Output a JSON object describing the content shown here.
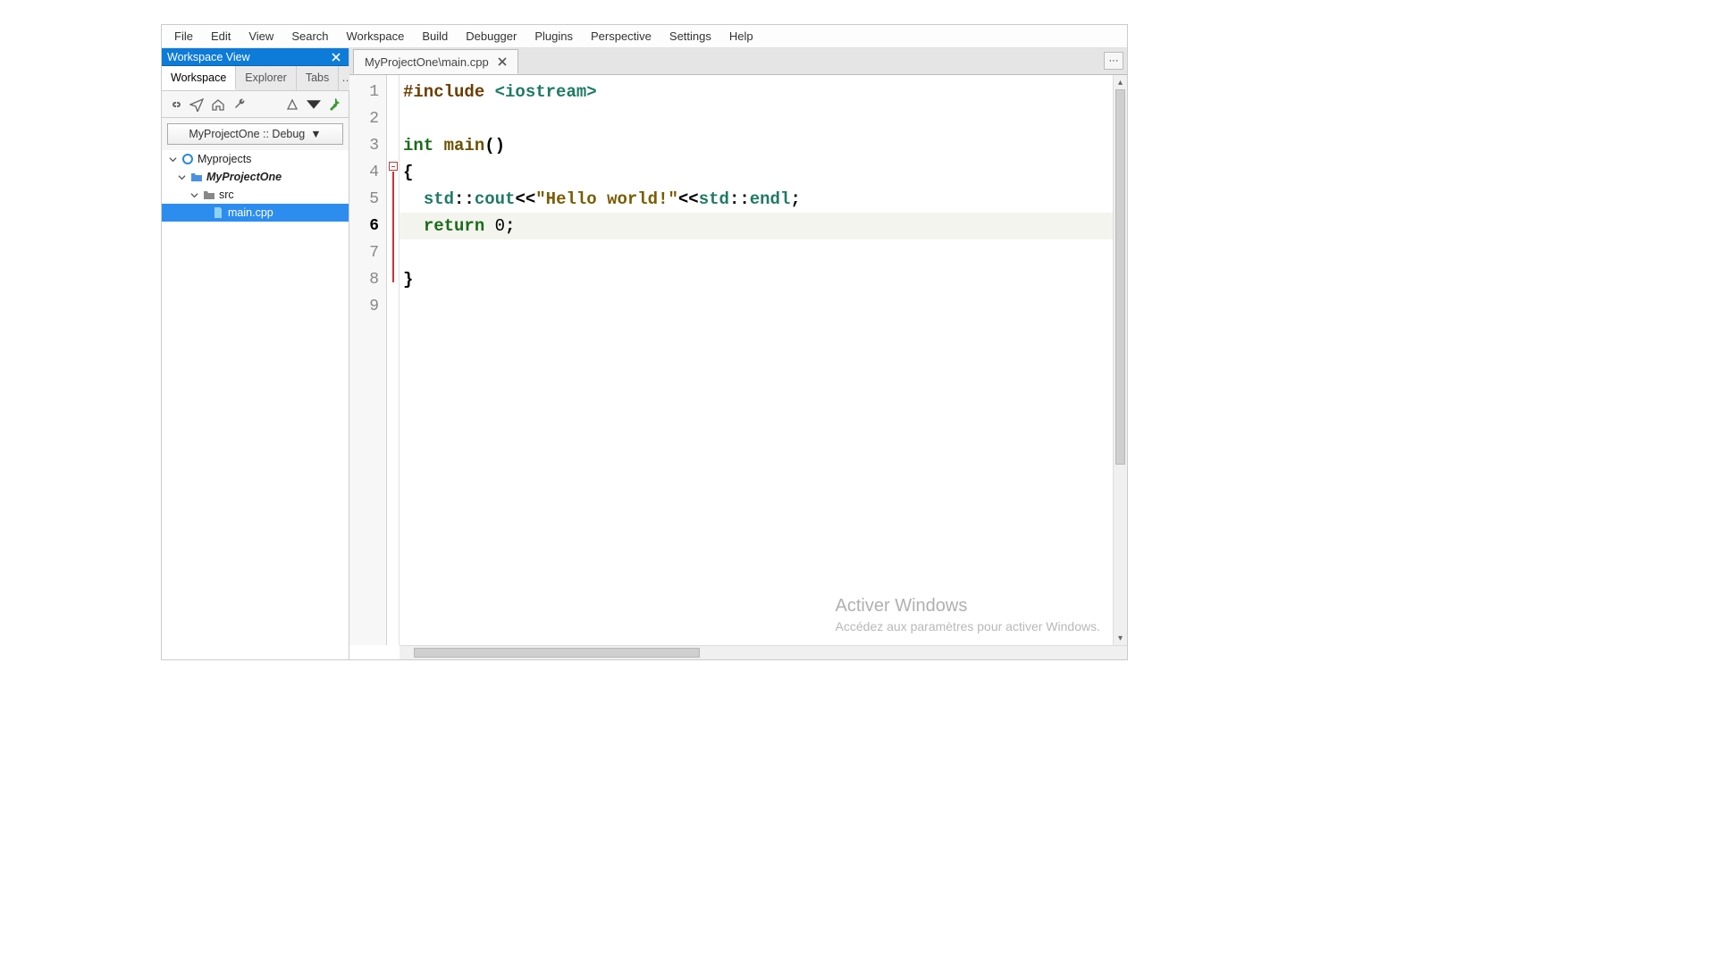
{
  "menu": {
    "items": [
      "File",
      "Edit",
      "View",
      "Search",
      "Workspace",
      "Build",
      "Debugger",
      "Plugins",
      "Perspective",
      "Settings",
      "Help"
    ]
  },
  "sidebar": {
    "panel_title": "Workspace View",
    "tabs": [
      "Workspace",
      "Explorer",
      "Tabs"
    ],
    "config": "MyProjectOne :: Debug",
    "tree": {
      "root": "Myprojects",
      "project": "MyProjectOne",
      "folder": "src",
      "file": "main.cpp"
    }
  },
  "editor": {
    "tab_label": "MyProjectOne\\main.cpp",
    "overflow_label": "···",
    "current_line": 6,
    "lines": [
      {
        "n": 1,
        "tokens": [
          [
            "pp",
            "#include "
          ],
          [
            "inc",
            "<iostream>"
          ]
        ]
      },
      {
        "n": 2,
        "tokens": []
      },
      {
        "n": 3,
        "tokens": [
          [
            "kw",
            "int "
          ],
          [
            "fn",
            "main"
          ],
          [
            "punct",
            "()"
          ]
        ]
      },
      {
        "n": 4,
        "tokens": [
          [
            "punct",
            "{"
          ]
        ]
      },
      {
        "n": 5,
        "tokens": [
          [
            "punct",
            "  "
          ],
          [
            "ident",
            "std"
          ],
          [
            "punct",
            "::"
          ],
          [
            "ident",
            "cout"
          ],
          [
            "punct",
            "<<"
          ],
          [
            "str",
            "\"Hello world!\""
          ],
          [
            "punct",
            "<<"
          ],
          [
            "ident",
            "std"
          ],
          [
            "punct",
            "::"
          ],
          [
            "ident",
            "endl"
          ],
          [
            "punct",
            ";"
          ]
        ]
      },
      {
        "n": 6,
        "tokens": [
          [
            "punct",
            "  "
          ],
          [
            "kw",
            "return "
          ],
          [
            "num",
            "0"
          ],
          [
            "punct",
            ";"
          ]
        ]
      },
      {
        "n": 7,
        "tokens": []
      },
      {
        "n": 8,
        "tokens": [
          [
            "punct",
            "}"
          ]
        ]
      },
      {
        "n": 9,
        "tokens": []
      }
    ]
  },
  "watermark": {
    "title": "Activer Windows",
    "subtitle": "Accédez aux paramètres pour activer Windows."
  }
}
